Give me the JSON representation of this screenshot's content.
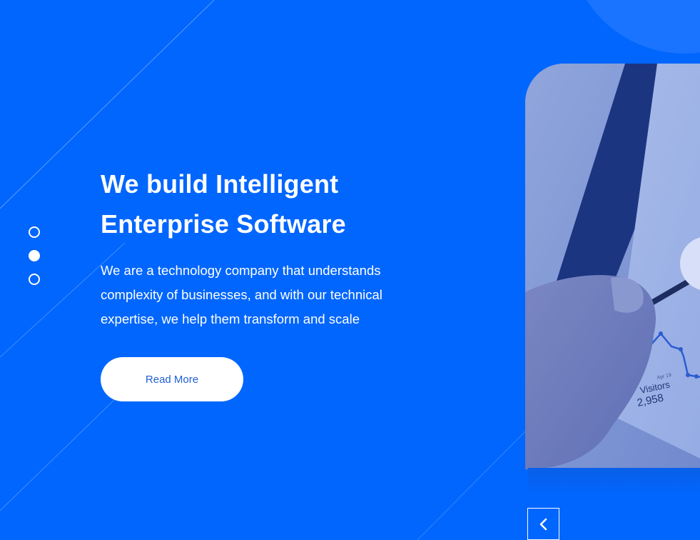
{
  "hero": {
    "headline_line1": "We build Intelligent",
    "headline_line2": "Enterprise Software",
    "description_line1": "We are a technology company that understands",
    "description_line2": "complexity of businesses, and with our technical",
    "description_line3": "expertise, we help them transform and scale",
    "cta_label": "Read More"
  },
  "slider": {
    "dot_count": 3,
    "active_dot": 2
  },
  "photo": {
    "chart_label": "Visitors",
    "chart_value": "2,958",
    "chart_date": "Apr 19"
  },
  "colors": {
    "background": "#0066fe",
    "accent_circle": "#1a74ff",
    "button_text": "#1f5fd6",
    "text": "#ffffff"
  },
  "icons": {
    "prev": "chevron-left-icon"
  }
}
